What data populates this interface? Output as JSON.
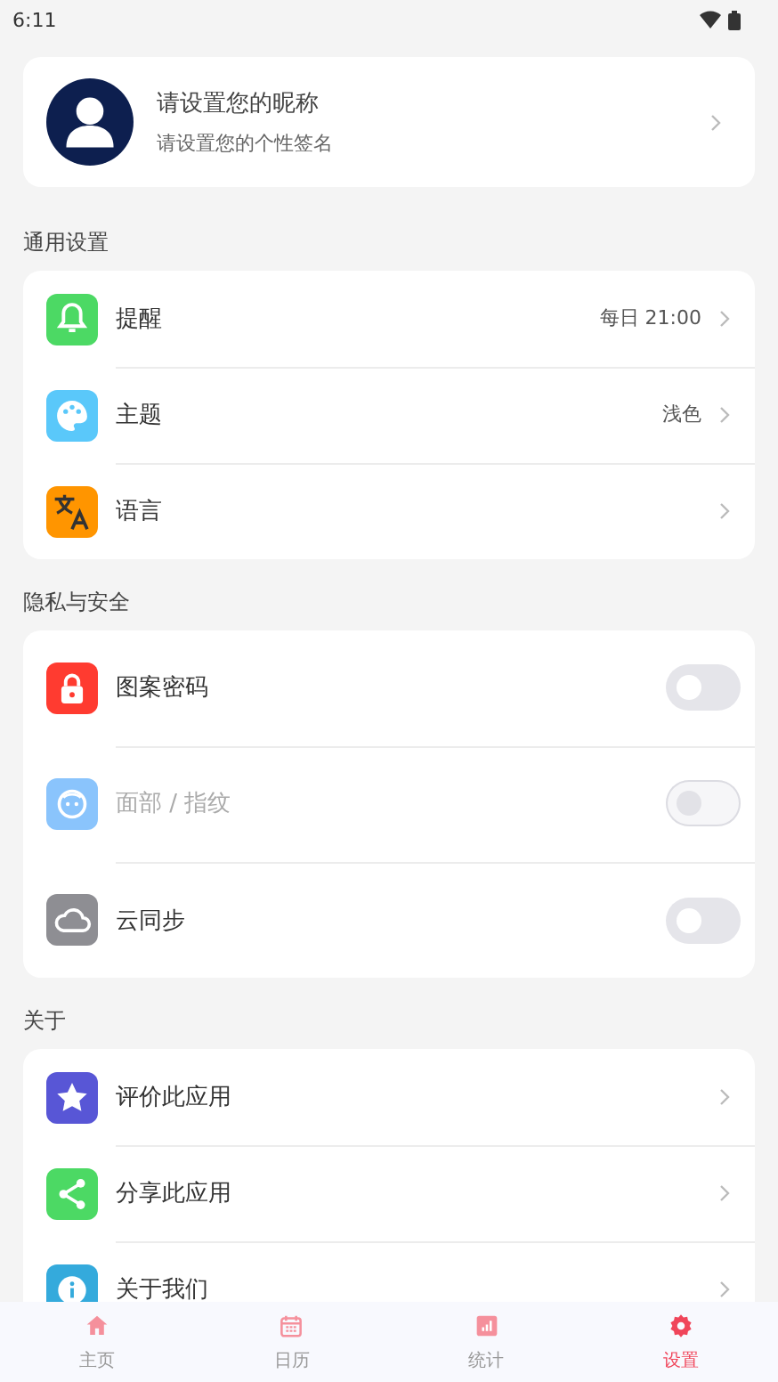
{
  "status_bar": {
    "time": "6:11"
  },
  "profile": {
    "nickname": "请设置您的昵称",
    "signature": "请设置您的个性签名"
  },
  "sections": [
    {
      "title": "通用设置",
      "items": [
        {
          "kind": "nav",
          "color": "#4cd964",
          "label": "提醒",
          "value": "每日 21:00"
        },
        {
          "kind": "nav",
          "color": "#5ac8fa",
          "label": "主题",
          "value": "浅色"
        },
        {
          "kind": "nav",
          "color": "#ff9500",
          "label": "语言"
        }
      ]
    },
    {
      "title": "隐私与安全",
      "items": [
        {
          "kind": "toggle",
          "color": "#ff3b30",
          "label": "图案密码",
          "on": false,
          "disabled": false
        },
        {
          "kind": "toggle",
          "color": "#8ac4fc",
          "label": "面部 / 指纹",
          "on": false,
          "disabled": true
        },
        {
          "kind": "toggle",
          "color": "#8e8e93",
          "label": "云同步",
          "on": false,
          "disabled": false
        }
      ]
    },
    {
      "title": "关于",
      "items": [
        {
          "kind": "nav",
          "color": "#5856d6",
          "label": "评价此应用"
        },
        {
          "kind": "nav",
          "color": "#4cd964",
          "label": "分享此应用"
        },
        {
          "kind": "nav",
          "color": "#34aadc",
          "label": "关于我们"
        }
      ]
    }
  ],
  "tabs": [
    {
      "label": "主页",
      "selected": false
    },
    {
      "label": "日历",
      "selected": false
    },
    {
      "label": "统计",
      "selected": false
    },
    {
      "label": "设置",
      "selected": true
    }
  ]
}
